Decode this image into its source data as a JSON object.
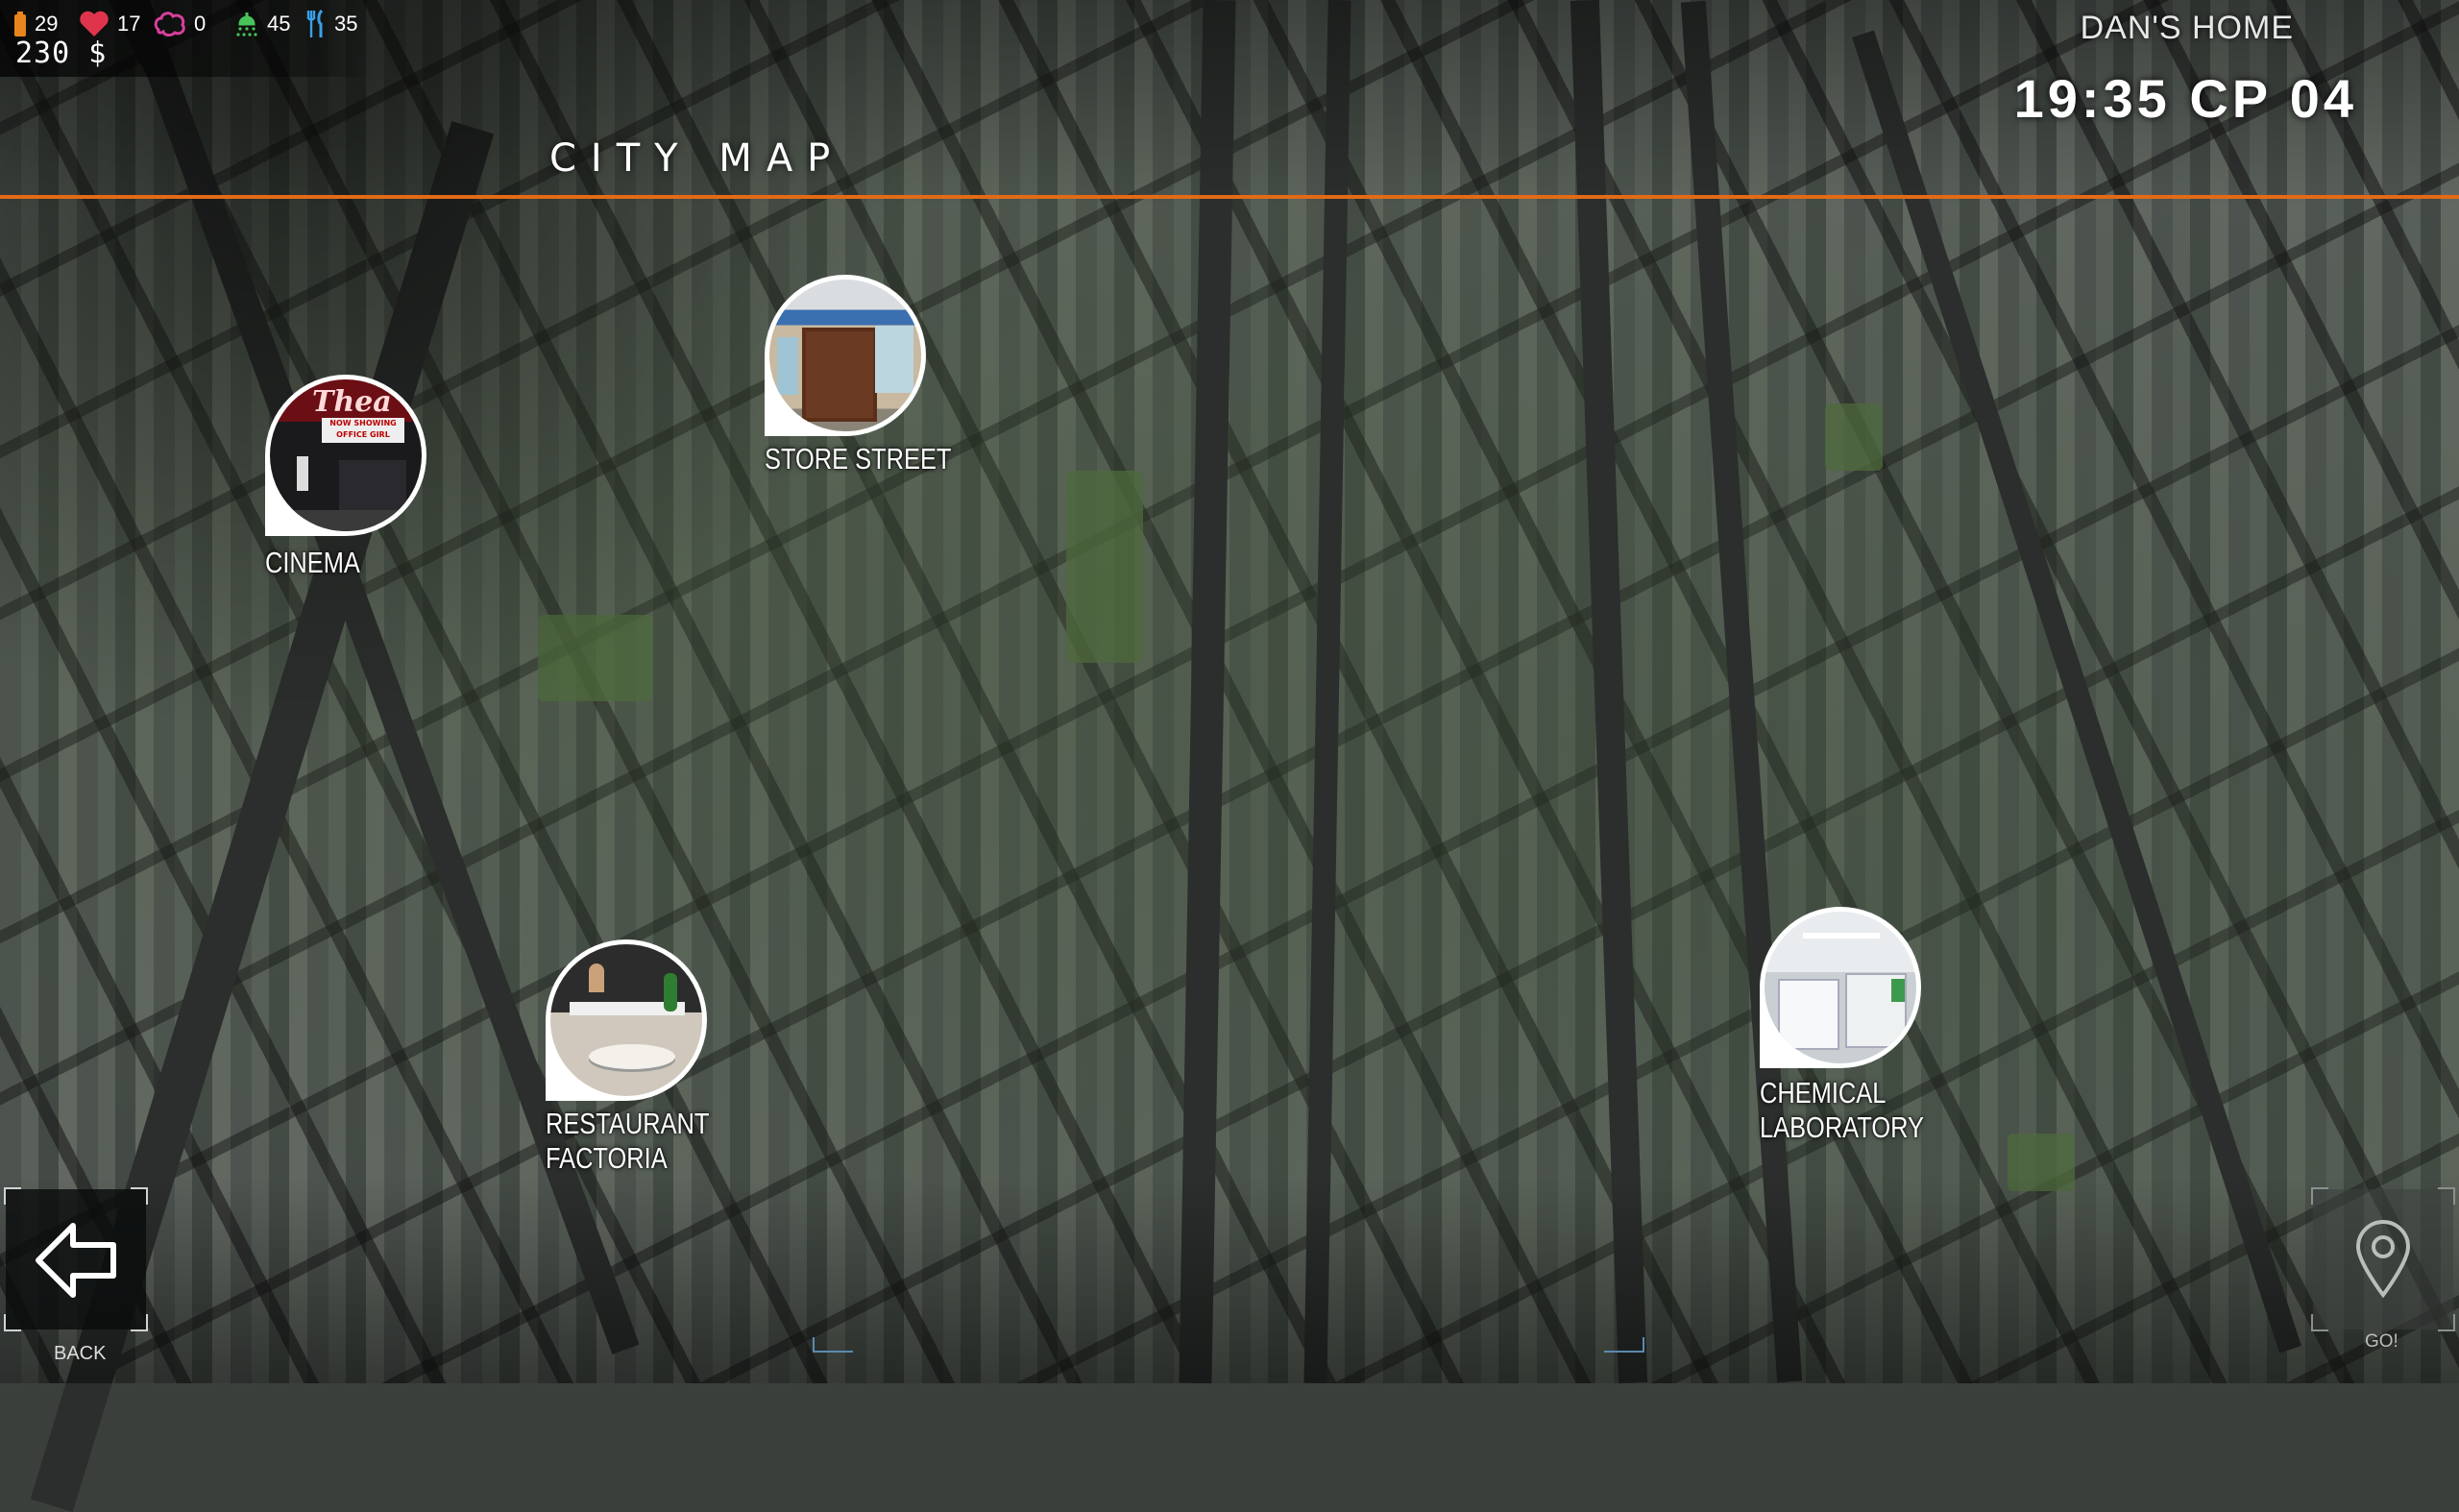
{
  "stats": {
    "energy": "29",
    "health": "17",
    "mood": "0",
    "hygiene": "45",
    "hunger": "35",
    "money": "230 $"
  },
  "icons": {
    "energy": "battery-icon",
    "health": "heart-icon",
    "mood": "brain-icon",
    "hygiene": "shower-icon",
    "hunger": "fork-knife-icon"
  },
  "colors": {
    "accent": "#e36a16",
    "energy": "#e8851c",
    "health": "#e0344d",
    "mood": "#d8409c",
    "hygiene": "#48c45a",
    "hunger": "#3aa0e8"
  },
  "header": {
    "title": "CITY MAP",
    "location": "DAN'S HOME",
    "time": "19:35 CP 04"
  },
  "locations": [
    {
      "name": "CINEMA",
      "line1": "CINEMA",
      "line2": ""
    },
    {
      "name": "STORE STREET",
      "line1": "STORE STREET",
      "line2": ""
    },
    {
      "name": "RESTAURANT FACTORIA",
      "line1": "RESTAURANT",
      "line2": "FACTORIA"
    },
    {
      "name": "CHEMICAL LABORATORY",
      "line1": "CHEMICAL",
      "line2": "LABORATORY"
    }
  ],
  "cinema_sign": {
    "line1": "Thea",
    "line2": "NOW SHOWING",
    "line3": "OFFICE GIRL"
  },
  "buttons": {
    "back": "BACK",
    "go": "GO!"
  }
}
